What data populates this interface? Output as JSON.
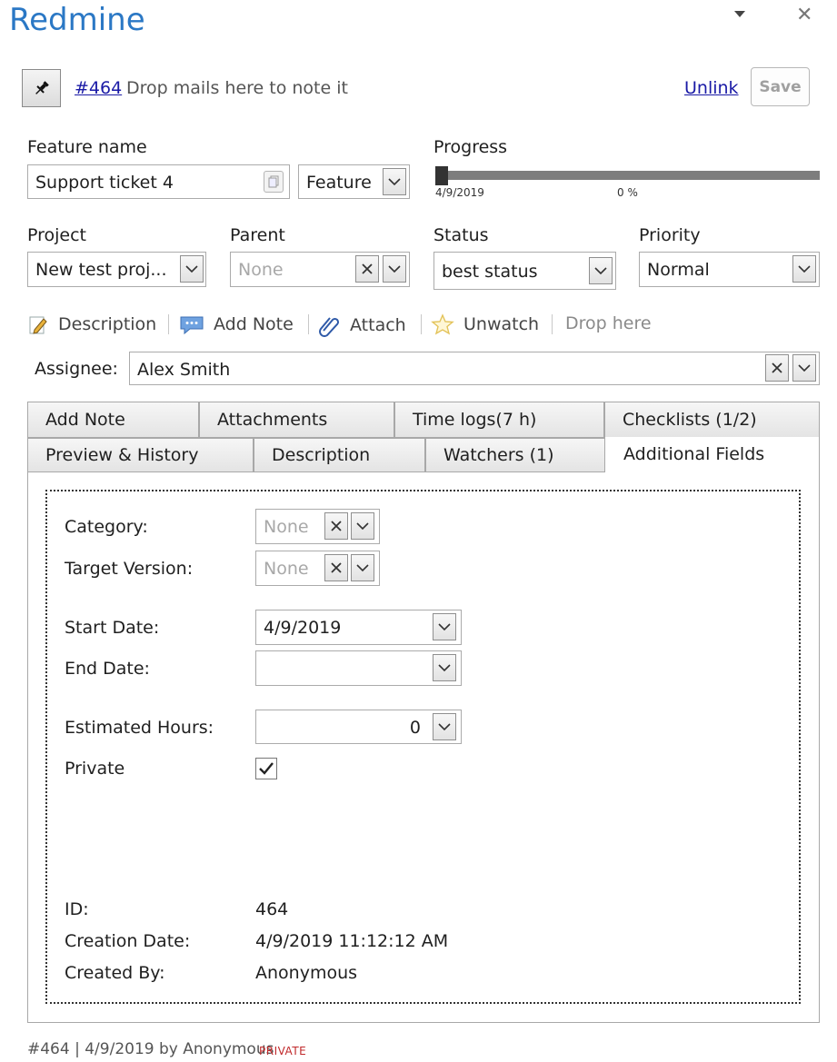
{
  "app": {
    "title": "Redmine"
  },
  "header": {
    "issue_link": "#464",
    "drop_text": "Drop mails here to note it",
    "unlink": "Unlink",
    "save": "Save"
  },
  "form": {
    "feature_name_label": "Feature name",
    "feature_name_value": "Support ticket 4",
    "tracker_value": "Feature",
    "progress_label": "Progress",
    "progress_date": "4/9/2019",
    "progress_percent": "0 %",
    "progress_fraction": 0,
    "project_label": "Project",
    "project_value": "New test proj...",
    "parent_label": "Parent",
    "parent_placeholder": "None",
    "status_label": "Status",
    "status_value": "best status",
    "priority_label": "Priority",
    "priority_value": "Normal"
  },
  "toolbar": {
    "description": "Description",
    "add_note": "Add Note",
    "attach": "Attach",
    "unwatch": "Unwatch",
    "drop_here": "Drop here"
  },
  "assignee": {
    "label": "Assignee:",
    "value": "Alex Smith"
  },
  "tabs": {
    "row1": [
      "Add Note",
      "Attachments",
      "Time logs(7 h)",
      "Checklists (1/2)"
    ],
    "row2": [
      "Preview & History",
      "Description",
      "Watchers (1)"
    ],
    "active": "Additional Fields"
  },
  "additional": {
    "category_label": "Category:",
    "category_placeholder": "None",
    "target_version_label": "Target Version:",
    "target_version_placeholder": "None",
    "start_date_label": "Start Date:",
    "start_date_value": "4/9/2019",
    "end_date_label": "End Date:",
    "end_date_value": "",
    "estimated_hours_label": "Estimated Hours:",
    "estimated_hours_value": "0",
    "private_label": "Private",
    "private_checked": true,
    "id_label": "ID:",
    "id_value": "464",
    "creation_date_label": "Creation Date:",
    "creation_date_value": "4/9/2019 11:12:12 AM",
    "created_by_label": "Created By:",
    "created_by_value": "Anonymous"
  },
  "footer": {
    "text": "#464 | 4/9/2019 by Anonymous",
    "badge": "PRIVATE"
  }
}
